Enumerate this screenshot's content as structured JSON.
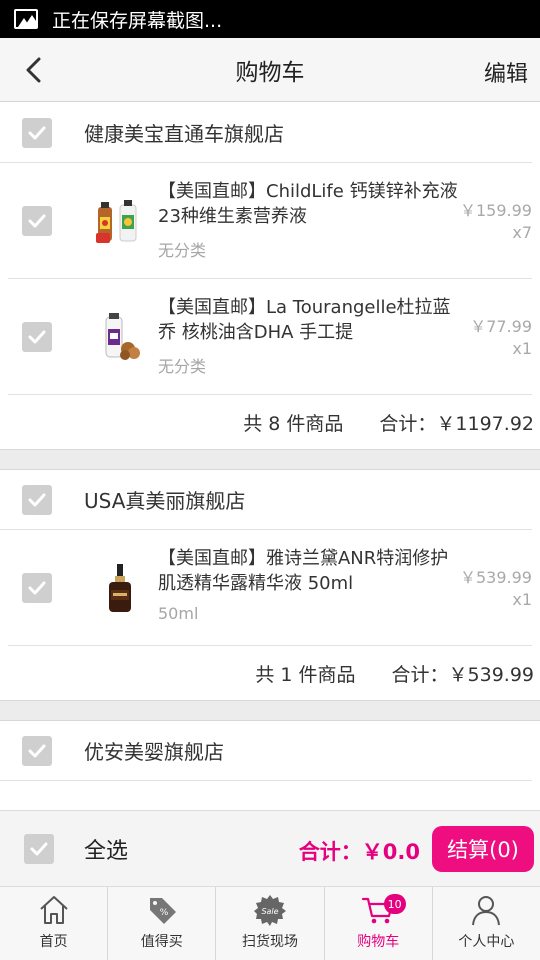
{
  "status_bar": {
    "text": "正在保存屏幕截图..."
  },
  "header": {
    "title": "购物车",
    "edit_label": "编辑"
  },
  "stores": [
    {
      "name": "健康美宝直通车旗舰店",
      "items": [
        {
          "title": "【美国直邮】ChildLife 钙镁锌补充液 23种维生素营养液",
          "spec": "无分类",
          "price": "￥159.99",
          "qty": "x7"
        },
        {
          "title": "【美国直邮】La Tourangelle杜拉蓝乔 核桃油含DHA 手工提",
          "spec": "无分类",
          "price": "￥77.99",
          "qty": "x1"
        }
      ],
      "summary_count": "共 8 件商品",
      "summary_total": "合计：￥1197.92"
    },
    {
      "name": "USA真美丽旗舰店",
      "items": [
        {
          "title": "【美国直邮】雅诗兰黛ANR特润修护肌透精华露精华液 50ml",
          "spec": "50ml",
          "price": "￥539.99",
          "qty": "x1"
        }
      ],
      "summary_count": "共 1 件商品",
      "summary_total": "合计：￥539.99"
    },
    {
      "name": "优安美婴旗舰店",
      "items": []
    }
  ],
  "footer": {
    "select_all_label": "全选",
    "total": "合计：￥0.0",
    "checkout_label": "结算(0)"
  },
  "tabs": [
    {
      "label": "首页",
      "icon": "home-icon"
    },
    {
      "label": "值得买",
      "icon": "percent-tag-icon"
    },
    {
      "label": "扫货现场",
      "icon": "sale-badge-icon"
    },
    {
      "label": "购物车",
      "icon": "cart-icon",
      "badge": "10",
      "active": true
    },
    {
      "label": "个人中心",
      "icon": "person-icon"
    }
  ],
  "colors": {
    "accent": "#e4007f",
    "checkout_bg": "#ee0e7f",
    "checkbox": "#cfcfcf"
  }
}
